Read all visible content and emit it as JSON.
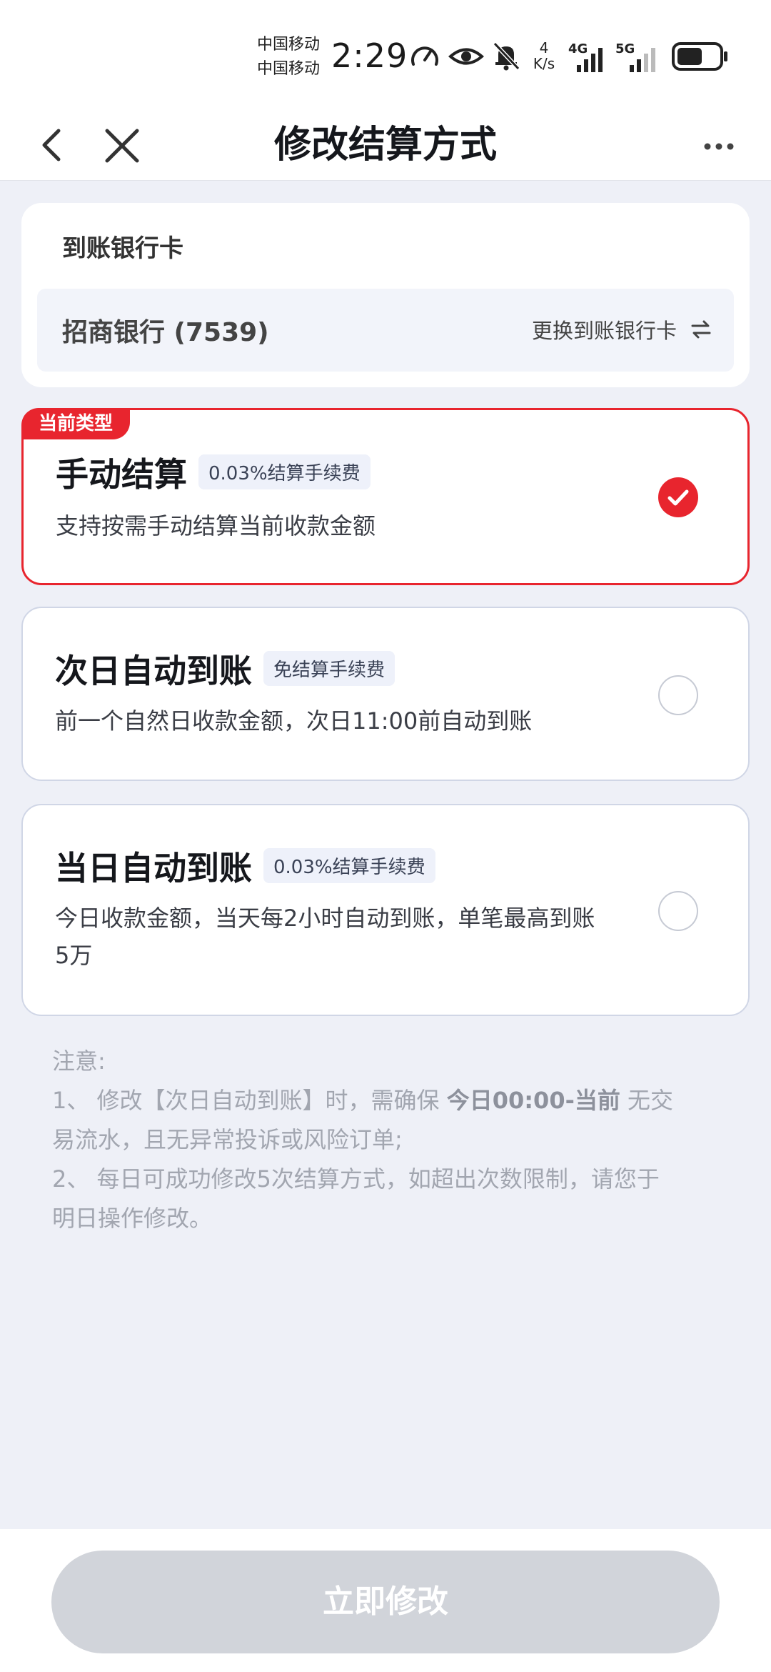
{
  "status_bar": {
    "carrier_1": "中国移动",
    "carrier_2": "中国移动",
    "time": "2:29",
    "speed_value": "4",
    "speed_unit": "K/s",
    "sim1_type": "4G",
    "sim2_type": "5G",
    "icons": [
      "speedometer-icon",
      "eye-icon",
      "bell-muted-icon",
      "signal-icon",
      "battery-icon"
    ]
  },
  "header": {
    "title": "修改结算方式",
    "back_icon": "chevron-left-icon",
    "close_icon": "close-icon",
    "more_icon": "more-icon"
  },
  "bank": {
    "label": "到账银行卡",
    "card_name": "招商银行 (7539)",
    "change_label": "更换到账银行卡",
    "change_icon": "swap-icon"
  },
  "options": [
    {
      "badge": "当前类型",
      "title": "手动结算",
      "tag": "0.03%结算手续费",
      "desc_line1": "支持按需手动结算当前收款金额",
      "selected": true
    },
    {
      "title": "次日自动到账",
      "tag": "免结算手续费",
      "desc_line1": "前一个自然日收款金额，次日11:00前自动到账",
      "selected": false
    },
    {
      "title": "当日自动到账",
      "tag": "0.03%结算手续费",
      "desc_line1": "今日收款金额，当天每2小时自动到账，单笔最高到账",
      "desc_line2": "5万",
      "selected": false
    }
  ],
  "notes": {
    "heading": "注意:",
    "item1_a": "1、 修改【次日自动到账】时，需确保 ",
    "item1_bold": "今日00:00-当前",
    "item1_b": " 无交",
    "item1_line2": "易流水，且无异常投诉或风险订单;",
    "item2_line1": "2、 每日可成功修改5次结算方式，如超出次数限制，请您于",
    "item2_line2": "明日操作修改。"
  },
  "submit_label": "立即修改",
  "colors": {
    "accent": "#e8252e",
    "background": "#eef0f7",
    "disabled_button": "#d1d4da"
  }
}
